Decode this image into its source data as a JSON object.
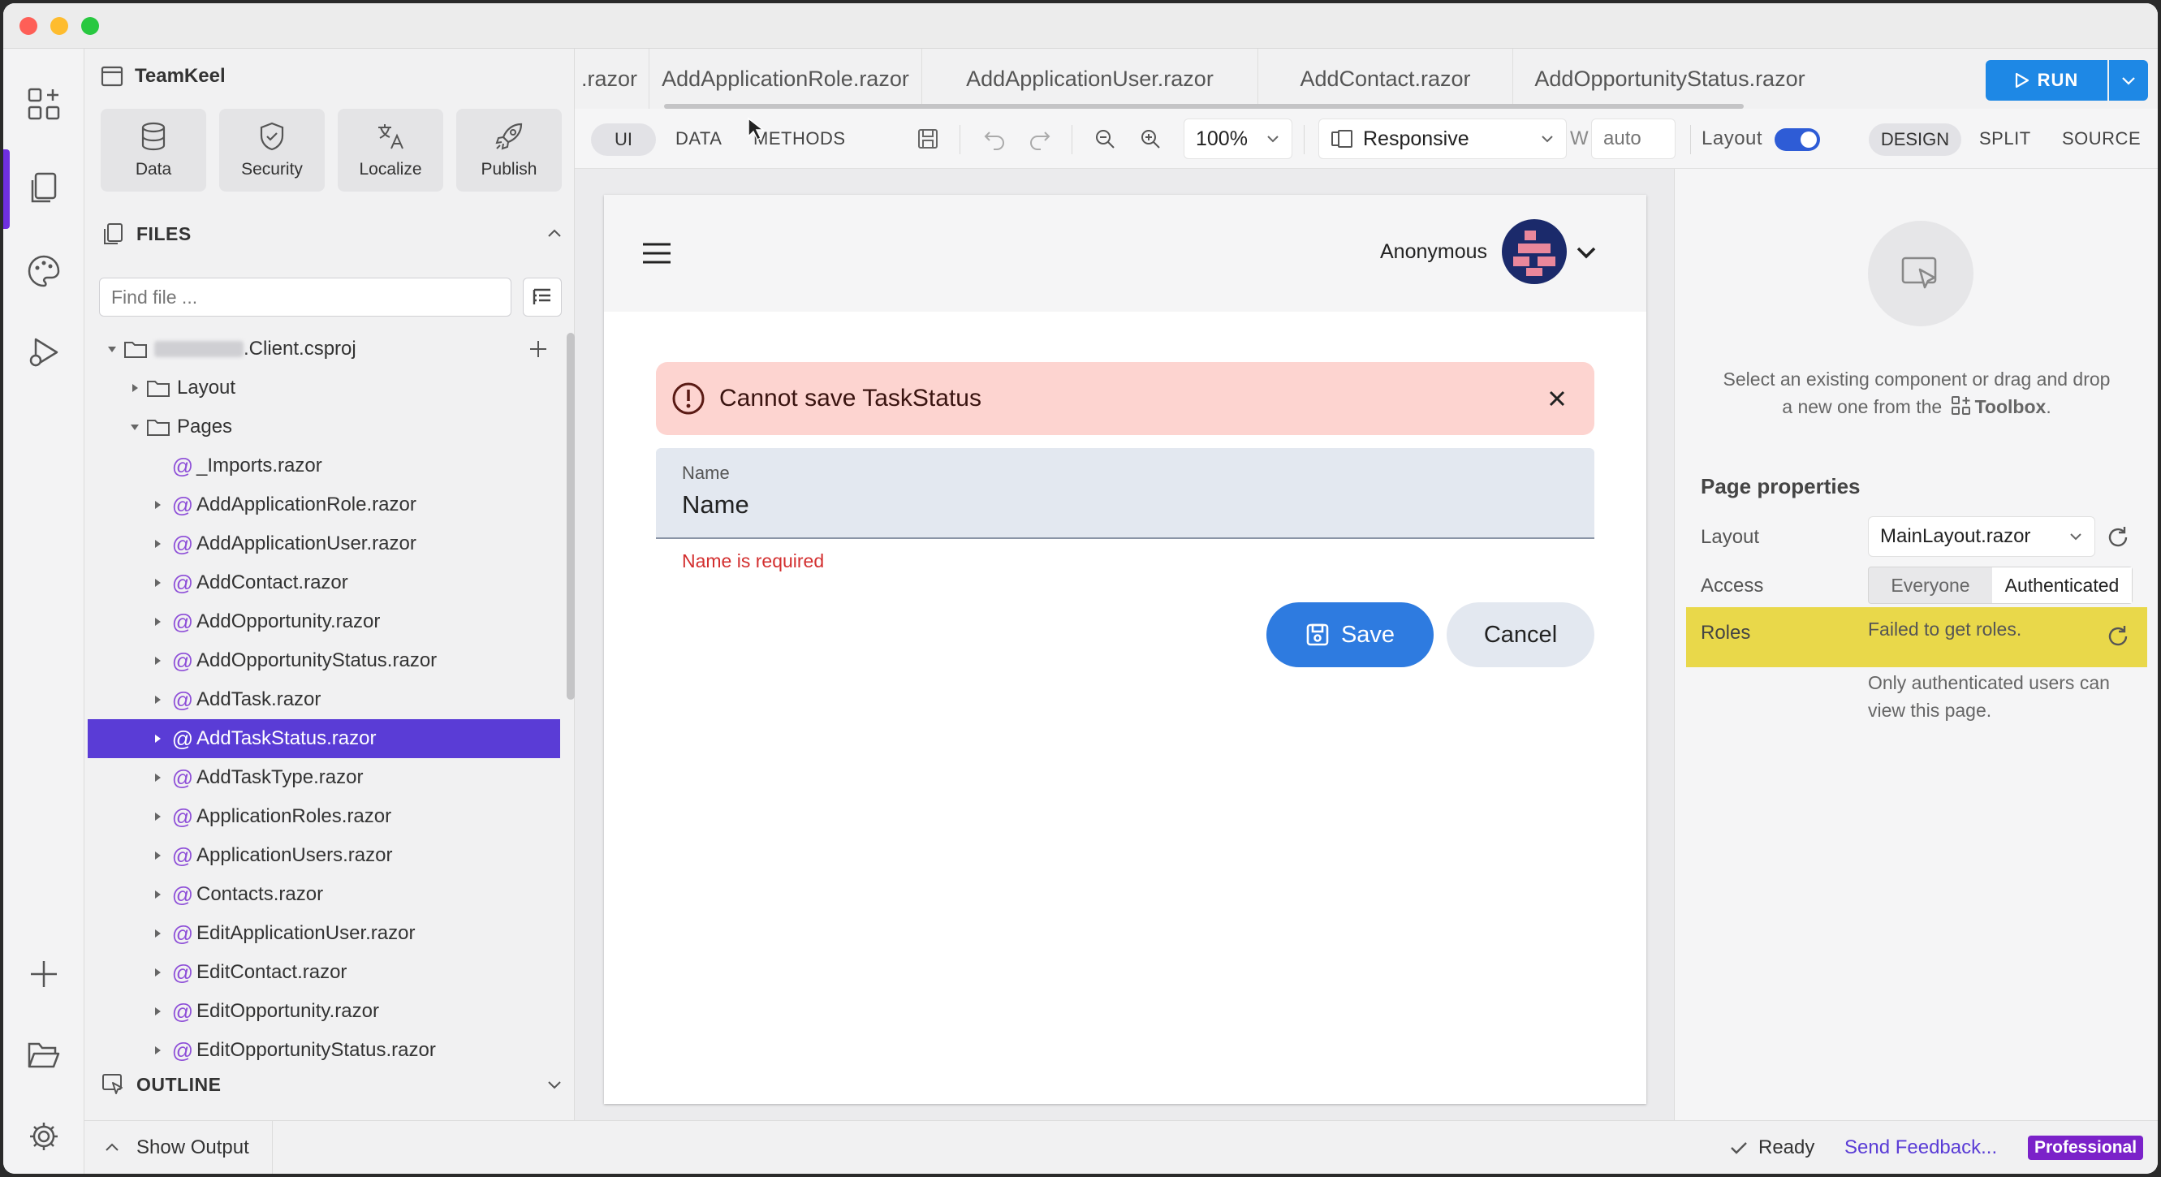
{
  "app": {
    "project_name": "TeamKeel"
  },
  "quick_actions": [
    "Data",
    "Security",
    "Localize",
    "Publish"
  ],
  "files": {
    "heading": "FILES",
    "search_placeholder": "Find file ...",
    "project": ".Client.csproj",
    "folders": [
      "Layout",
      "Pages"
    ],
    "pages": [
      "_Imports.razor",
      "AddApplicationRole.razor",
      "AddApplicationUser.razor",
      "AddContact.razor",
      "AddOpportunity.razor",
      "AddOpportunityStatus.razor",
      "AddTask.razor",
      "AddTaskStatus.razor",
      "AddTaskType.razor",
      "ApplicationRoles.razor",
      "ApplicationUsers.razor",
      "Contacts.razor",
      "EditApplicationUser.razor",
      "EditContact.razor",
      "EditOpportunity.razor",
      "EditOpportunityStatus.razor"
    ],
    "selected": "AddTaskStatus.razor"
  },
  "outline": {
    "heading": "OUTLINE"
  },
  "tabs": [
    ".razor",
    "AddApplicationRole.razor",
    "AddApplicationUser.razor",
    "AddContact.razor",
    "AddOpportunityStatus.razor"
  ],
  "run": {
    "label": "RUN"
  },
  "toolbar": {
    "modes": [
      "UI",
      "DATA",
      "METHODS"
    ],
    "zoom": "100%",
    "device": "Responsive",
    "width_label": "W",
    "width_placeholder": "auto",
    "layout_label": "Layout",
    "layout_on": true,
    "views": [
      "DESIGN",
      "SPLIT",
      "SOURCE"
    ]
  },
  "preview": {
    "user_name": "Anonymous",
    "alert_text": "Cannot save TaskStatus",
    "field_label": "Name",
    "field_value": "Name",
    "validation": "Name is required",
    "save_label": "Save",
    "cancel_label": "Cancel"
  },
  "properties": {
    "hint_part1": "Select an existing component or drag and drop",
    "hint_part2": "a new one from the",
    "hint_toolbox": "Toolbox",
    "hint_end": ".",
    "heading": "Page properties",
    "layout_label": "Layout",
    "layout_value": "MainLayout.razor",
    "access_label": "Access",
    "access_options": [
      "Everyone",
      "Authenticated"
    ],
    "access_selected": "Authenticated",
    "roles_label": "Roles",
    "roles_error": "Failed to get roles.",
    "note_line1": "Only authenticated users can",
    "note_line2": "view this page."
  },
  "status": {
    "output": "Show Output",
    "ready": "Ready",
    "feedback": "Send Feedback...",
    "plan": "Professional"
  },
  "colors": {
    "accent": "#5a3cd6",
    "run": "#1e88e5",
    "save": "#2e7be0",
    "alert_bg": "#fdd4d0",
    "highlight": "#e9d84a",
    "plan_badge": "#7b22c9"
  }
}
